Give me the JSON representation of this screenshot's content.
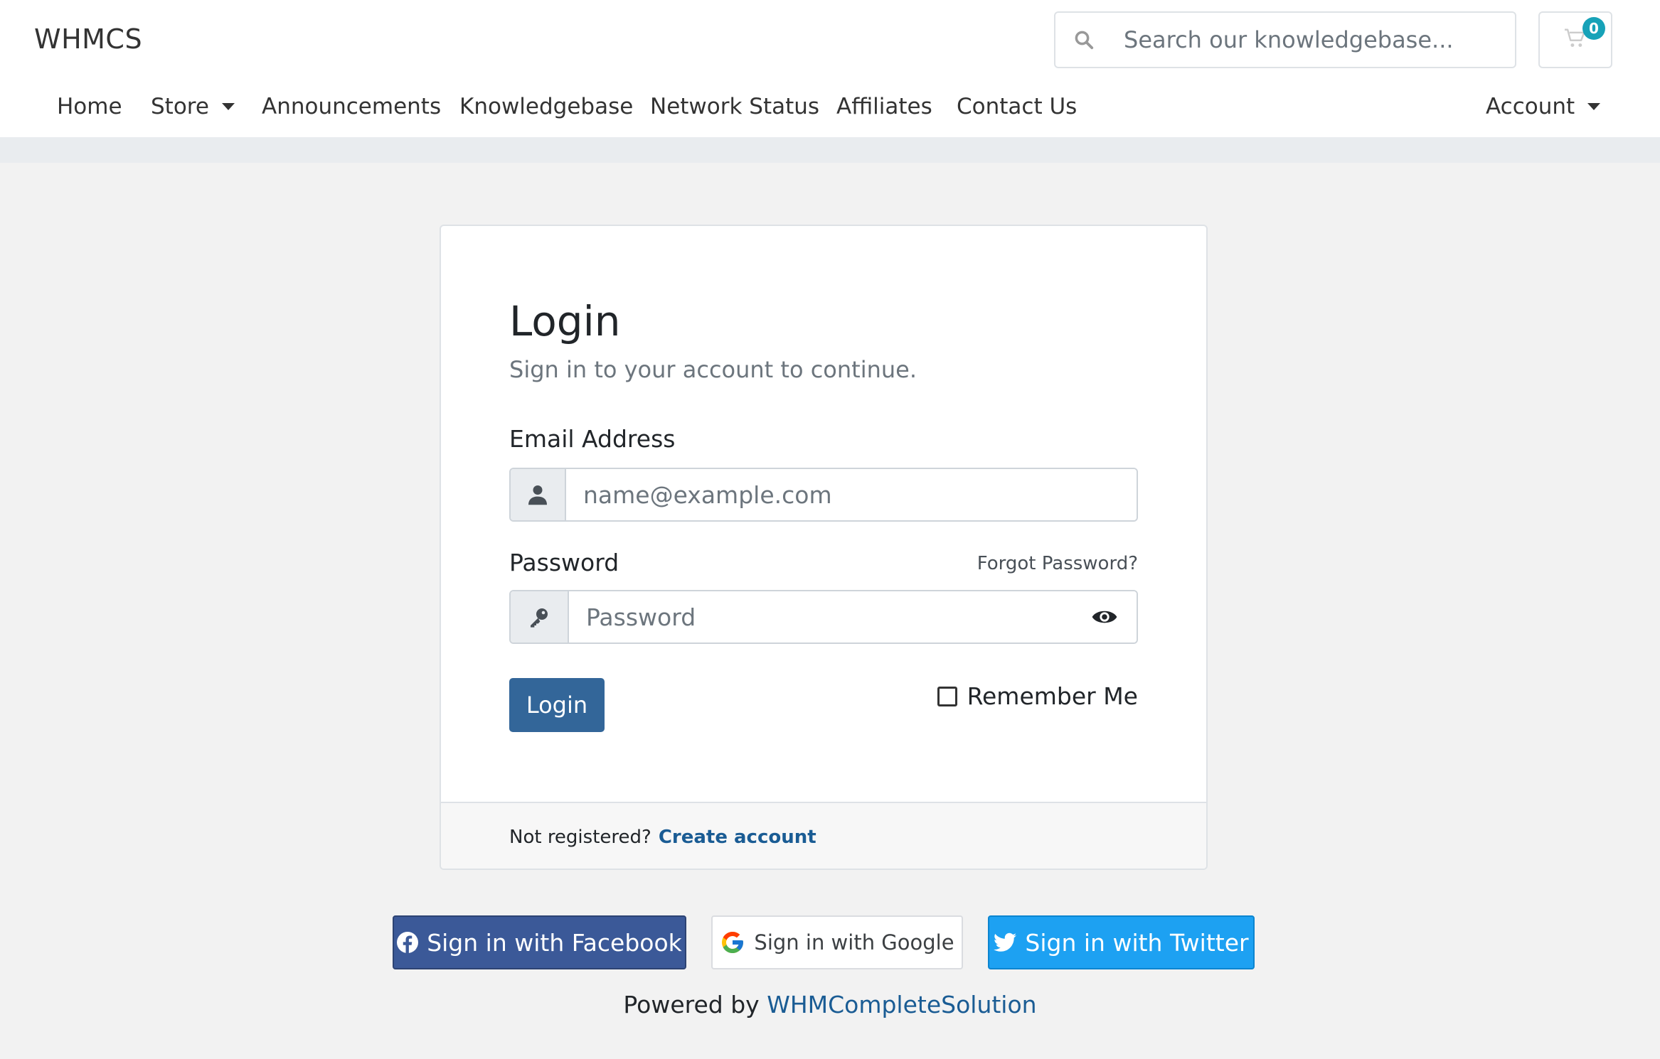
{
  "header": {
    "brand": "WHMCS",
    "search_placeholder": "Search our knowledgebase...",
    "cart_count": "0"
  },
  "nav": {
    "items": [
      {
        "label": "Home"
      },
      {
        "label": "Store"
      },
      {
        "label": "Announcements"
      },
      {
        "label": "Knowledgebase"
      },
      {
        "label": "Network Status"
      },
      {
        "label": "Affiliates"
      },
      {
        "label": "Contact Us"
      }
    ],
    "account_label": "Account"
  },
  "login": {
    "title": "Login",
    "subtitle": "Sign in to your account to continue.",
    "email_label": "Email Address",
    "email_placeholder": "name@example.com",
    "password_label": "Password",
    "password_placeholder": "Password",
    "forgot_label": "Forgot Password?",
    "login_button": "Login",
    "remember_label": "Remember Me",
    "not_registered": "Not registered?",
    "create_account": "Create account"
  },
  "social": {
    "facebook": "Sign in with Facebook",
    "google": "Sign in with Google",
    "twitter": "Sign in with Twitter"
  },
  "footer": {
    "powered_prefix": "Powered by",
    "powered_link": "WHMCompleteSolution"
  },
  "colors": {
    "primary": "#336699",
    "link": "#1a5c94",
    "badge": "#17a2b8",
    "facebook": "#3b5998",
    "twitter": "#1da1f2"
  }
}
